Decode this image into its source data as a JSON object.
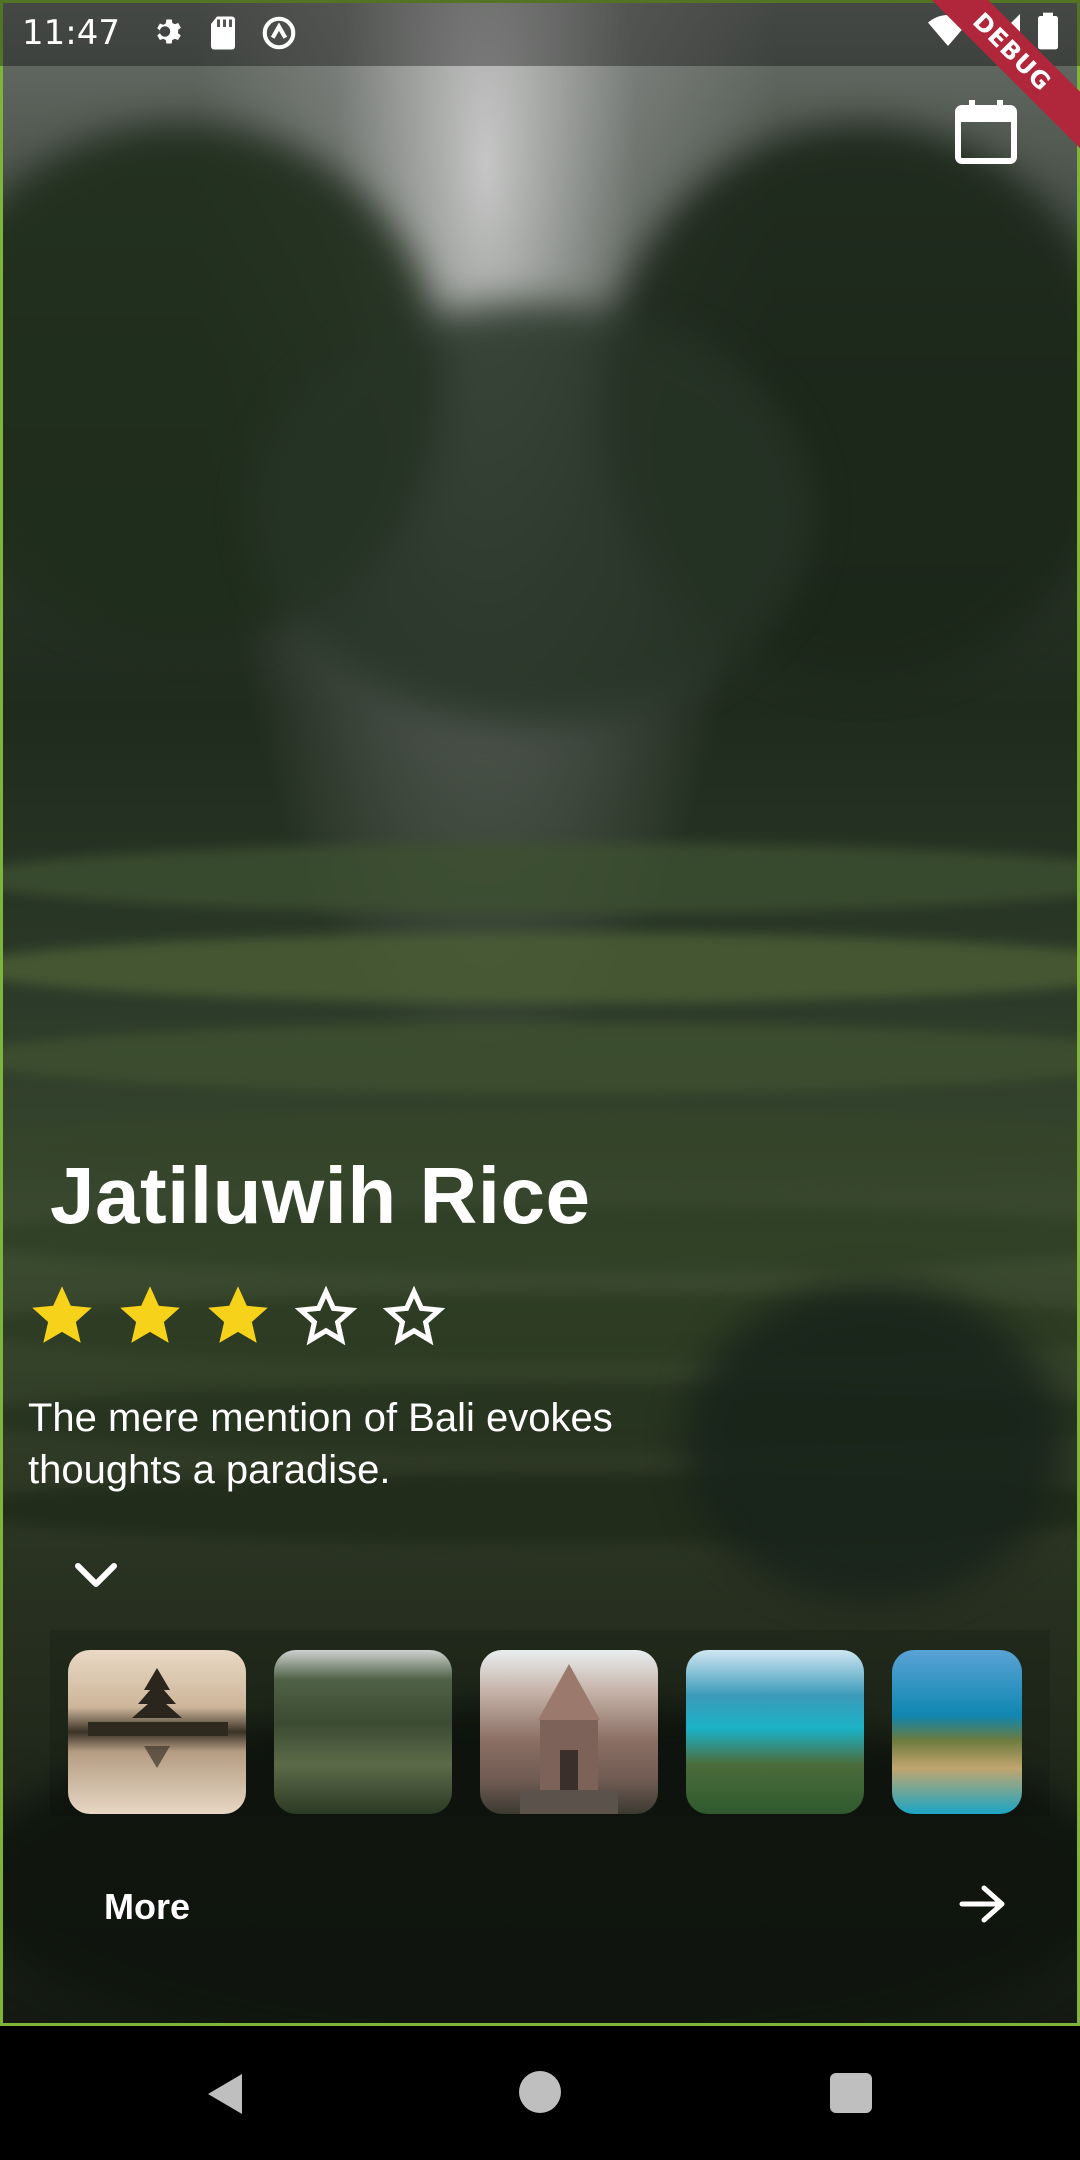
{
  "status_bar": {
    "time": "11:47",
    "icons_left": [
      "settings-icon",
      "sd-card-icon",
      "sync-icon"
    ],
    "icons_right": [
      "wifi-icon",
      "signal-icon",
      "battery-icon"
    ],
    "debug_label": "DEBUG"
  },
  "header": {
    "calendar_icon": "calendar-icon"
  },
  "place": {
    "title": "Jatiluwih Rice",
    "rating": 3,
    "rating_max": 5,
    "description": "The mere mention of Bali evokes thoughts a paradise."
  },
  "gallery": {
    "images": [
      {
        "name": "temple-lake"
      },
      {
        "name": "rice-terraces"
      },
      {
        "name": "stone-temple-gate"
      },
      {
        "name": "turquoise-coast"
      },
      {
        "name": "cliff-beach"
      }
    ]
  },
  "footer": {
    "more_label": "More",
    "arrow_icon": "arrow-right-icon"
  },
  "colors": {
    "accent_border": "#7fb43a",
    "star_fill": "#f7d21a",
    "debug_banner": "#b0263a"
  }
}
